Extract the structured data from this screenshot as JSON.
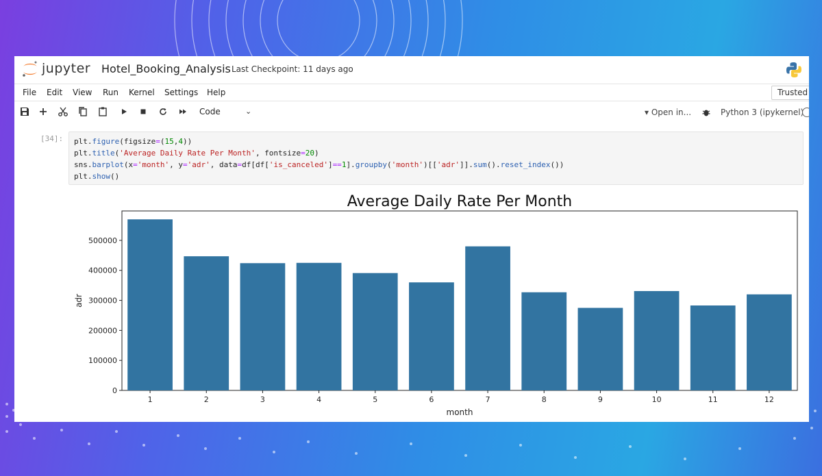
{
  "app": {
    "brand": "jupyter",
    "notebook_title": "Hotel_Booking_Analysis",
    "checkpoint": "Last Checkpoint: 11 days ago"
  },
  "menu": {
    "items": [
      "File",
      "Edit",
      "View",
      "Run",
      "Kernel",
      "Settings",
      "Help"
    ],
    "trusted_label": "Trusted"
  },
  "toolbar": {
    "icons": [
      "save-icon",
      "add-cell-icon",
      "cut-icon",
      "copy-icon",
      "paste-icon",
      "run-icon",
      "stop-icon",
      "restart-icon",
      "fast-forward-icon"
    ],
    "cell_type": "Code",
    "open_in": "Open in...",
    "kernel": "Python 3 (ipykernel)"
  },
  "cell": {
    "prompt": "[34]:",
    "lines": [
      "plt.figure(figsize=(15,4))",
      "plt.title('Average Daily Rate Per Month', fontsize=20)",
      "sns.barplot(x='month', y='adr', data=df[df['is_canceled']==1].groupby('month')[['adr']].sum().reset_index())",
      "plt.show()"
    ]
  },
  "chart_data": {
    "type": "bar",
    "title": "Average Daily Rate Per Month",
    "xlabel": "month",
    "ylabel": "adr",
    "categories": [
      "1",
      "2",
      "3",
      "4",
      "5",
      "6",
      "7",
      "8",
      "9",
      "10",
      "11",
      "12"
    ],
    "values": [
      570000,
      447000,
      424000,
      425000,
      391000,
      360000,
      480000,
      327000,
      275000,
      331000,
      283000,
      320000
    ],
    "yticks": [
      "0",
      "100000",
      "200000",
      "300000",
      "400000",
      "500000"
    ],
    "ylim": [
      0,
      598000
    ],
    "bar_color": "#3274a1",
    "grid": false
  }
}
